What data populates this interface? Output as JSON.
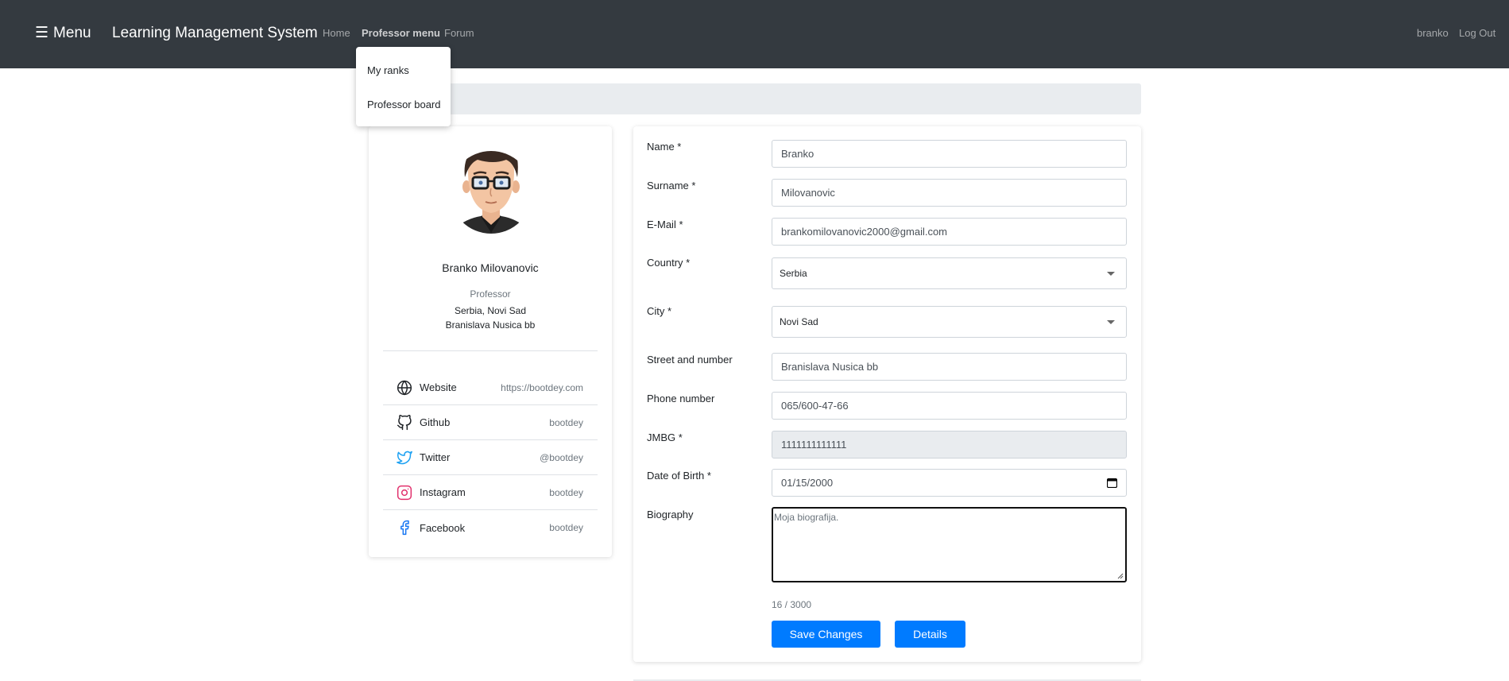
{
  "navbar": {
    "menu_label": "Menu",
    "hamburger_glyph": "☰",
    "brand": "Learning Management System",
    "links": {
      "home": "Home",
      "professor_menu": "Professor menu",
      "forum": "Forum",
      "user": "branko",
      "logout": "Log Out"
    }
  },
  "dropdown": {
    "items": [
      "My ranks",
      "Professor board"
    ]
  },
  "profile": {
    "name": "Branko Milovanovic",
    "role": "Professor",
    "location": "Serbia, Novi Sad",
    "street": "Branislava Nusica bb",
    "social": [
      {
        "icon": "globe-icon",
        "label": "Website",
        "value": "https://bootdey.com"
      },
      {
        "icon": "github-icon",
        "label": "Github",
        "value": "bootdey"
      },
      {
        "icon": "twitter-icon",
        "label": "Twitter",
        "value": "@bootdey"
      },
      {
        "icon": "instagram-icon",
        "label": "Instagram",
        "value": "bootdey"
      },
      {
        "icon": "facebook-icon",
        "label": "Facebook",
        "value": "bootdey"
      }
    ]
  },
  "form": {
    "name": {
      "label": "Name *",
      "value": "Branko"
    },
    "surname": {
      "label": "Surname *",
      "value": "Milovanovic"
    },
    "email": {
      "label": "E-Mail *",
      "value": "brankomilovanovic2000@gmail.com"
    },
    "country": {
      "label": "Country *",
      "value": "Serbia"
    },
    "city": {
      "label": "City *",
      "value": "Novi Sad"
    },
    "street": {
      "label": "Street and number",
      "value": "Branislava Nusica bb"
    },
    "phone": {
      "label": "Phone number",
      "value": "065/600-47-66"
    },
    "jmbg": {
      "label": "JMBG *",
      "value": "1111111111111"
    },
    "dob": {
      "label": "Date of Birth *",
      "value": "01/15/2000"
    },
    "biography": {
      "label": "Biography",
      "value": "Moja biografija."
    },
    "char_count": "16 / 3000",
    "save_label": "Save Changes",
    "details_label": "Details"
  },
  "colors": {
    "navbar_bg": "#343a40",
    "primary": "#007bff",
    "twitter": "#1da1f2",
    "instagram": "#e1306c",
    "facebook": "#1877f2"
  }
}
